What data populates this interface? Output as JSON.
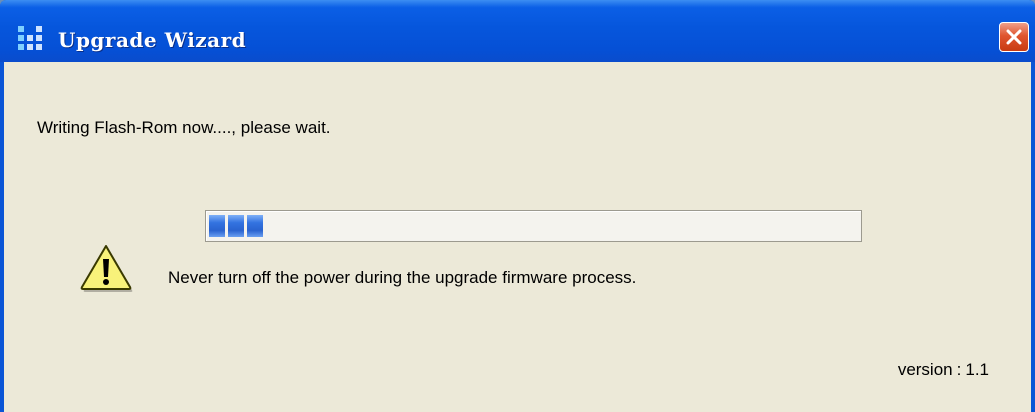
{
  "window": {
    "title": "Upgrade Wizard",
    "icon": "app-grid-icon",
    "close_icon": "close-icon"
  },
  "status": {
    "message": "Writing Flash-Rom now...., please wait."
  },
  "progress": {
    "segments_filled": 3,
    "fill_color": "#2a63cf"
  },
  "warning": {
    "icon": "warning-icon",
    "message": "Never turn off the power during the upgrade firmware process."
  },
  "version": {
    "label": "version",
    "separator": ":",
    "value": "1.1"
  },
  "colors": {
    "titlebar": "#0656dc",
    "client_background": "#ece9d8",
    "close_button": "#e0552f"
  }
}
